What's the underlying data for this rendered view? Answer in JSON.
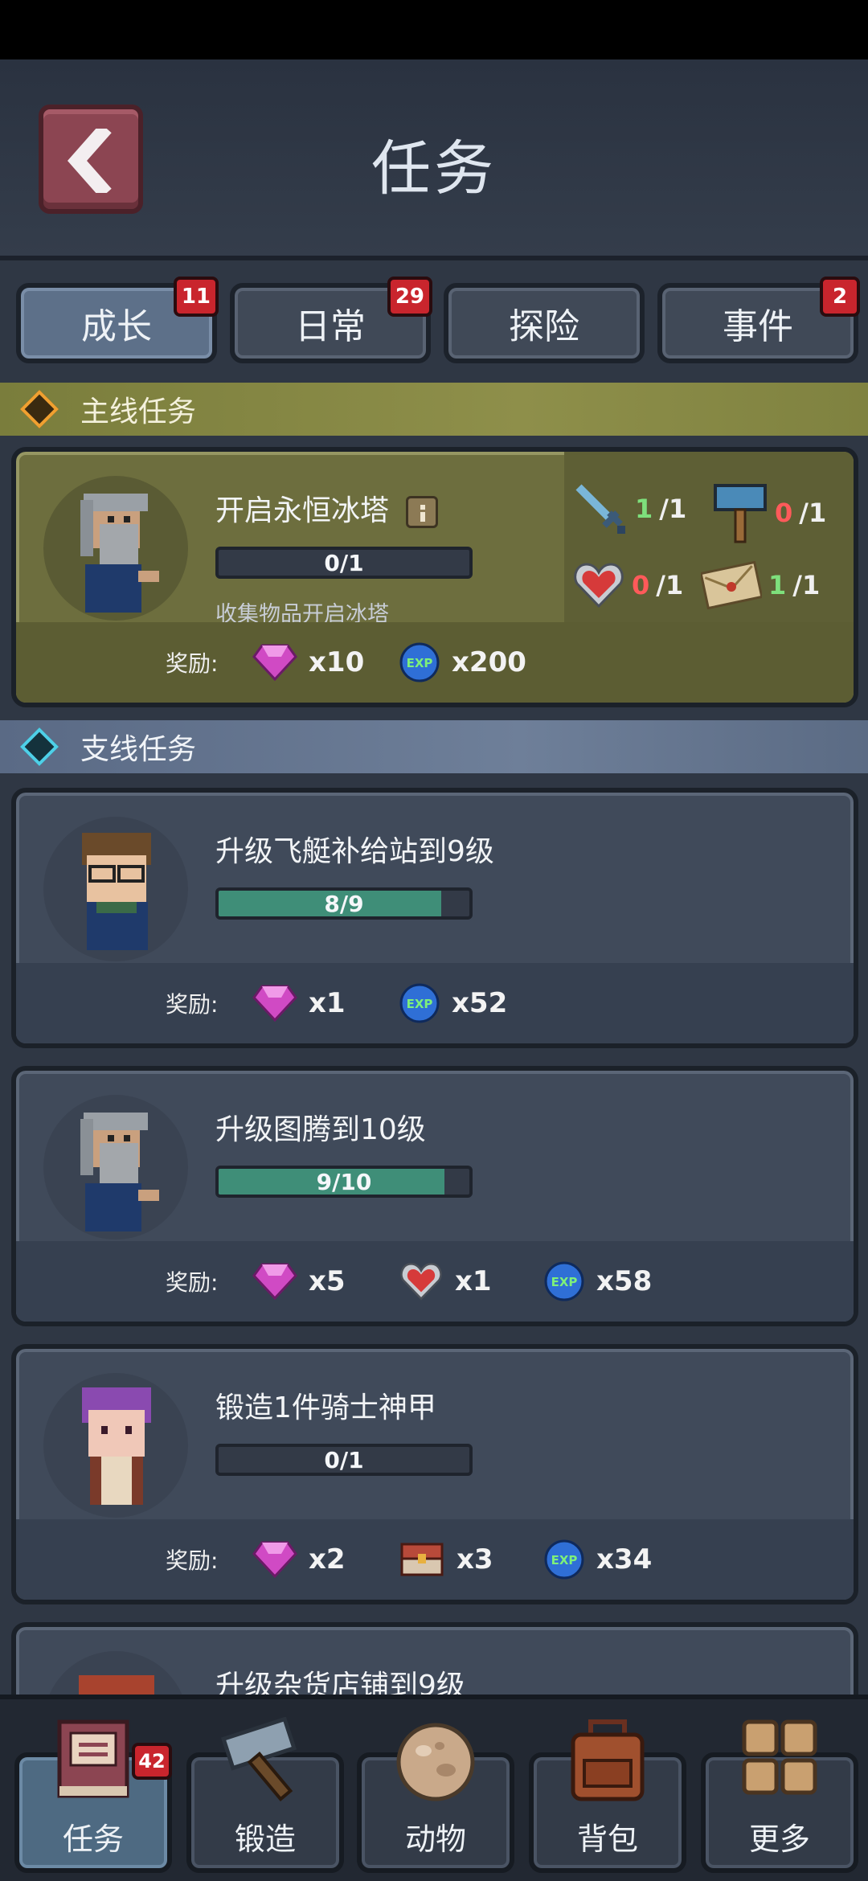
{
  "header": {
    "title": "任务"
  },
  "tabs": [
    {
      "label": "成长",
      "badge": "11"
    },
    {
      "label": "日常",
      "badge": "29"
    },
    {
      "label": "探险",
      "badge": ""
    },
    {
      "label": "事件",
      "badge": "2"
    }
  ],
  "main_section": {
    "title": "主线任务",
    "quest": {
      "name": "开启永恒冰塔",
      "progress_text": "0/1",
      "progress": 0,
      "description": "收集物品开启冰塔",
      "requirements": [
        {
          "icon": "sword-icon",
          "have": "1",
          "need": "/1"
        },
        {
          "icon": "hammer-icon",
          "have": "0",
          "need": "/1"
        },
        {
          "icon": "heart-icon",
          "have": "0",
          "need": "/1"
        },
        {
          "icon": "envelope-icon",
          "have": "1",
          "need": "/1"
        }
      ],
      "reward_label": "奖励:",
      "rewards": [
        {
          "icon": "gem-icon",
          "amount": "x10"
        },
        {
          "icon": "exp-icon",
          "amount": "x200"
        }
      ]
    }
  },
  "side_section": {
    "title": "支线任务",
    "quests": [
      {
        "name": "升级飞艇补给站到9级",
        "progress_text": "8/9",
        "progress": 0.889,
        "reward_label": "奖励:",
        "rewards": [
          {
            "icon": "gem-icon",
            "amount": "x1"
          },
          {
            "icon": "exp-icon",
            "amount": "x52"
          }
        ]
      },
      {
        "name": "升级图腾到10级",
        "progress_text": "9/10",
        "progress": 0.9,
        "reward_label": "奖励:",
        "rewards": [
          {
            "icon": "gem-icon",
            "amount": "x5"
          },
          {
            "icon": "heart-icon",
            "amount": "x1"
          },
          {
            "icon": "exp-icon",
            "amount": "x58"
          }
        ]
      },
      {
        "name": "锻造1件骑士神甲",
        "progress_text": "0/1",
        "progress": 0,
        "reward_label": "奖励:",
        "rewards": [
          {
            "icon": "gem-icon",
            "amount": "x2"
          },
          {
            "icon": "chest-icon",
            "amount": "x3"
          },
          {
            "icon": "exp-icon",
            "amount": "x34"
          }
        ]
      },
      {
        "name": "升级杂货店铺到9级"
      }
    ]
  },
  "bottom_nav": [
    {
      "label": "任务",
      "badge": "42",
      "icon": "book-icon"
    },
    {
      "label": "锻造",
      "badge": "",
      "icon": "hammer-icon"
    },
    {
      "label": "动物",
      "badge": "",
      "icon": "egg-icon"
    },
    {
      "label": "背包",
      "badge": "",
      "icon": "backpack-icon"
    },
    {
      "label": "更多",
      "badge": "",
      "icon": "grid-icon"
    }
  ],
  "colors": {
    "background": "#2f3744",
    "main_card": "#6d6e3e",
    "side_card": "#404a5a",
    "progress_fill": "#3f8e78",
    "badge": "#c9252d",
    "ok_green": "#7ee07c",
    "missing_red": "#ff5a5a"
  }
}
